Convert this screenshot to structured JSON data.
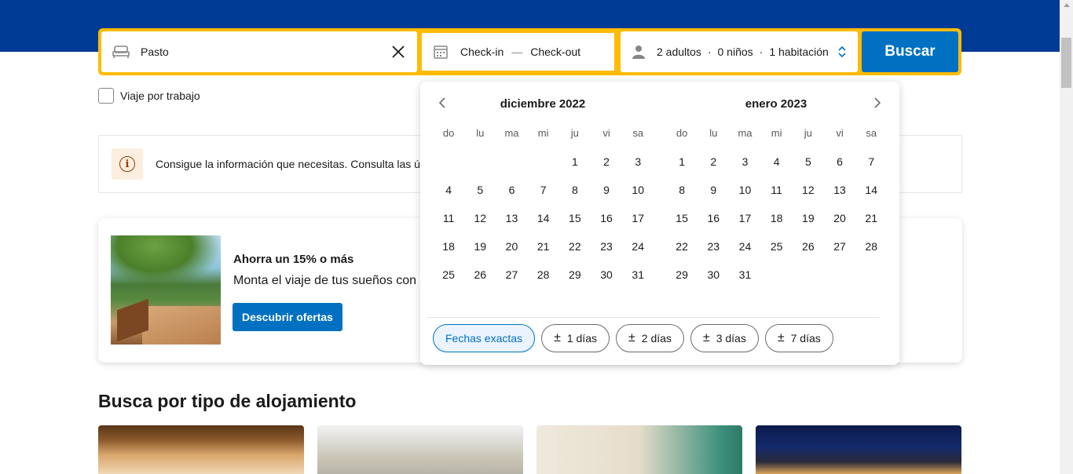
{
  "search": {
    "destination_value": "Pasto",
    "checkin_label": "Check-in",
    "separator": "—",
    "checkout_label": "Check-out",
    "occupancy": {
      "adults": "2 adultos",
      "dot1": "·",
      "children": "0 niños",
      "dot2": "·",
      "rooms": "1 habitación"
    },
    "search_button": "Buscar"
  },
  "business_trip_label": "Viaje por trabajo",
  "info_banner_text": "Consigue la información que necesitas. Consulta las últ",
  "promo": {
    "title": "Ahorra un 15% o más",
    "subtitle": "Monta el viaje de tus sueños con l",
    "button": "Descubrir ofertas"
  },
  "section_title": "Busca por tipo de alojamiento",
  "calendar": {
    "weekdays": [
      "do",
      "lu",
      "ma",
      "mi",
      "ju",
      "vi",
      "sa"
    ],
    "months": [
      {
        "title": "diciembre 2022",
        "weeks": [
          [
            "",
            "",
            "",
            "",
            "1",
            "2",
            "3"
          ],
          [
            "4",
            "5",
            "6",
            "7",
            "8",
            "9",
            "10"
          ],
          [
            "11",
            "12",
            "13",
            "14",
            "15",
            "16",
            "17"
          ],
          [
            "18",
            "19",
            "20",
            "21",
            "22",
            "23",
            "24"
          ],
          [
            "25",
            "26",
            "27",
            "28",
            "29",
            "30",
            "31"
          ]
        ]
      },
      {
        "title": "enero 2023",
        "weeks": [
          [
            "1",
            "2",
            "3",
            "4",
            "5",
            "6",
            "7"
          ],
          [
            "8",
            "9",
            "10",
            "11",
            "12",
            "13",
            "14"
          ],
          [
            "15",
            "16",
            "17",
            "18",
            "19",
            "20",
            "21"
          ],
          [
            "22",
            "23",
            "24",
            "25",
            "26",
            "27",
            "28"
          ],
          [
            "29",
            "30",
            "31",
            "",
            "",
            "",
            ""
          ]
        ]
      }
    ],
    "flex_options": [
      {
        "label": "Fechas exactas",
        "active": true
      },
      {
        "label": "1 días",
        "active": false
      },
      {
        "label": "2 días",
        "active": false
      },
      {
        "label": "3 días",
        "active": false
      },
      {
        "label": "7 días",
        "active": false
      }
    ],
    "flex_prefix": "±"
  },
  "colors": {
    "brand_dark": "#003b95",
    "accent_yellow": "#febb02",
    "primary_blue": "#0071c2"
  }
}
